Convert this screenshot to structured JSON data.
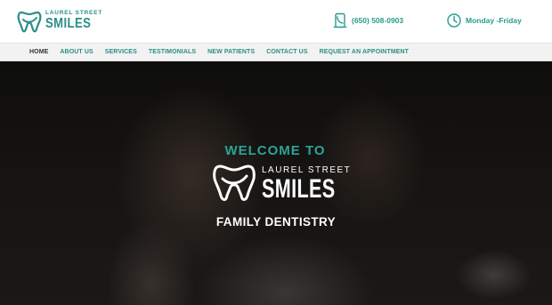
{
  "header": {
    "logo": {
      "line1": "LAUREL STREET",
      "line2": "SMILES"
    },
    "phone": {
      "icon": "phone-icon",
      "text": "(650) 508-0903"
    },
    "hours": {
      "icon": "clock-icon",
      "text": "Monday -Friday"
    }
  },
  "nav": {
    "items": [
      {
        "label": "HOME",
        "active": true
      },
      {
        "label": "ABOUT US"
      },
      {
        "label": "SERVICES"
      },
      {
        "label": "TESTIMONIALS"
      },
      {
        "label": "NEW PATIENTS"
      },
      {
        "label": "CONTACT US"
      },
      {
        "label": "REQUEST AN APPOINTMENT"
      }
    ]
  },
  "hero": {
    "welcome": "WELCOME TO",
    "logo": {
      "line1": "LAUREL STREET",
      "line2": "SMILES"
    },
    "tagline": "FAMILY DENTISTRY"
  },
  "colors": {
    "accent": "#2a9b8f",
    "nav_bg": "#f2f2f2",
    "active_nav": "#333333"
  }
}
